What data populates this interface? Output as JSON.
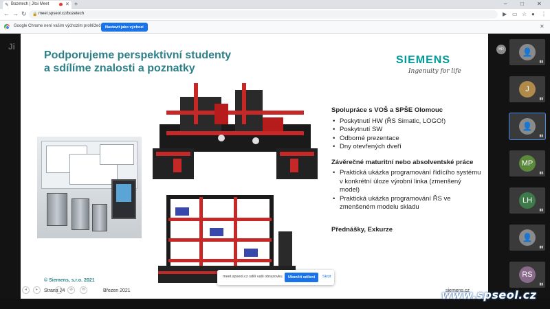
{
  "browser": {
    "tab_title": "Bozetech | Jitsi Meet",
    "url": "meet.spseol.cz/bozetech",
    "infobar_message": "Google Chrome není vaším výchozím prohlížečem",
    "infobar_button": "Nastavit jako výchozí"
  },
  "slide": {
    "title_line1": "Podporujeme perspektivní studenty",
    "title_line2": "a sdílíme znalosti a poznatky",
    "logo": "SIEMENS",
    "tagline": "Ingenuity for life",
    "section1_heading": "Spolupráce s VOŠ  a SPŠE Olomouc",
    "section1_items": [
      "Poskytnutí HW (ŘS Simatic, LOGO!)",
      "Poskytnutí SW",
      "Odborné prezentace",
      "Dny otevřených dveří"
    ],
    "section2_heading": "Závěrečné maturitní nebo absolventské práce",
    "section2_items": [
      "Praktická ukázka programování řídícího systému v konkrétní úloze výrobní linka (zmenšený model)",
      "Praktická ukázka programování ŘS ve zmenšeném modelu skladu"
    ],
    "section3_heading": "Přednášky, Exkurze",
    "copyright": "© Siemens, s.r.o. 2021",
    "page": "Strana 24",
    "date": "Březen 2021",
    "website": "siemens.cz"
  },
  "share_banner": {
    "text": "meet.spseol.cz sdílí vaši obrazovku.",
    "stop_button": "Ukončit sdílení",
    "hide_button": "Skrýt"
  },
  "participants": [
    {
      "initials": "",
      "color": "#8a8a8a"
    },
    {
      "initials": "J",
      "color": "#b08a4a"
    },
    {
      "initials": "",
      "color": "#8a8a8a"
    },
    {
      "initials": "MP",
      "color": "#5b8a3c"
    },
    {
      "initials": "LH",
      "color": "#3f7a4a"
    },
    {
      "initials": "",
      "color": "#8a8a8a"
    },
    {
      "initials": "RS",
      "color": "#8a6a8a"
    }
  ],
  "self_badge": "HD",
  "watermark": "www.spseol.cz",
  "colors": {
    "accent": "#2d7f88",
    "siemens": "#009999",
    "chrome_blue": "#1a73e8"
  }
}
